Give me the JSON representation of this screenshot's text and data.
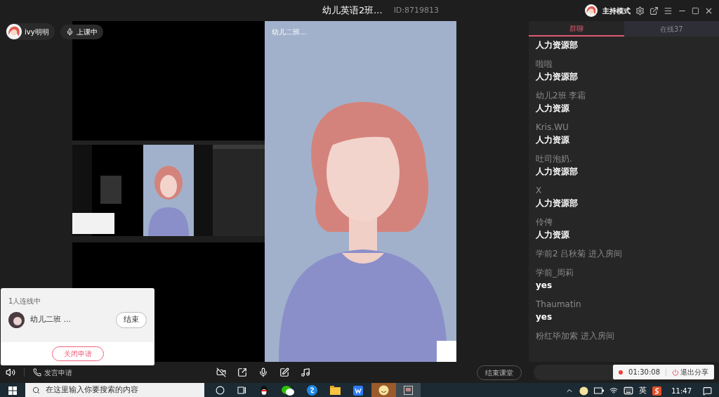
{
  "title": "幼儿英语2班...",
  "room_id": "ID:8719813",
  "host_mode": "主持模式",
  "user": {
    "name": "ivy明明"
  },
  "class_status": "上课中",
  "video_tile": {
    "label": "幼儿二班..."
  },
  "tabs": [
    {
      "label": "群聊",
      "selected": true
    },
    {
      "label": "在线37",
      "selected": false
    }
  ],
  "chat": [
    {
      "kind": "message",
      "message": "人力资源部"
    },
    {
      "kind": "message",
      "name": "啦啦",
      "message": "人力资源部"
    },
    {
      "kind": "message",
      "name": "幼儿2班 李霜",
      "message": "人力资源"
    },
    {
      "kind": "message",
      "name": "Kris.WU",
      "message": "人力资源"
    },
    {
      "kind": "message",
      "name": "吐司泡奶.",
      "message": "人力资源部"
    },
    {
      "kind": "message",
      "name": "X",
      "message": "人力资源部"
    },
    {
      "kind": "message",
      "name": "伶俜",
      "message": "人力资源"
    },
    {
      "kind": "system",
      "text": "学前2  吕秋菊 进入房间"
    },
    {
      "kind": "message",
      "name": "学前_周莉",
      "message": "yes"
    },
    {
      "kind": "message",
      "name": "Thaumatin",
      "message": "yes"
    },
    {
      "kind": "system",
      "text": "粉红毕加索 进入房间"
    }
  ],
  "link_panel": {
    "count": "1人连线中",
    "participant": "幼儿二班 ...",
    "end_button": "结束",
    "close_button": "关闭申请"
  },
  "bottom_bar": {
    "speak_request": "发言申请",
    "end_class": "结束课堂"
  },
  "share_pill": {
    "timer": "01:30:08",
    "exit": "退出分享"
  },
  "taskbar": {
    "search_placeholder": "在这里输入你要搜索的内容",
    "ime": "英",
    "time": "11:47"
  }
}
